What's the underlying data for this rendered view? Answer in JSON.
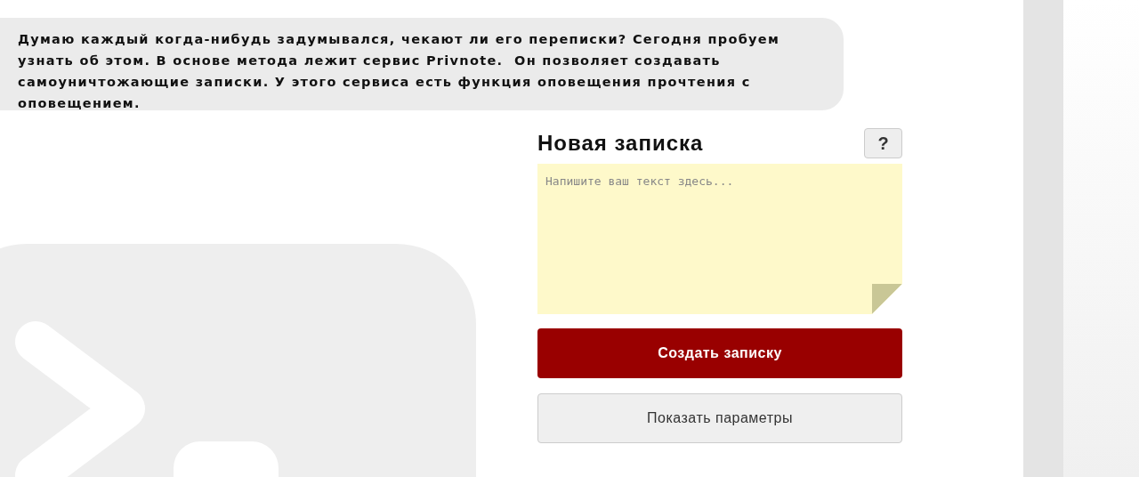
{
  "message": {
    "text": "Думаю каждый когда-нибудь задумывался, чекают ли его переписки? Сегодня пробуем узнать об этом. В основе метода лежит сервис Privnote.  Он позволяет создавать самоуничтожающие записки. У этого сервиса есть функция оповещения прочтения с оповещением."
  },
  "note_form": {
    "title": "Новая записка",
    "help_button": "?",
    "textarea": {
      "placeholder": "Напишите ваш текст здесь..."
    },
    "create_button": "Создать записку",
    "options_button": "Показать параметры"
  }
}
